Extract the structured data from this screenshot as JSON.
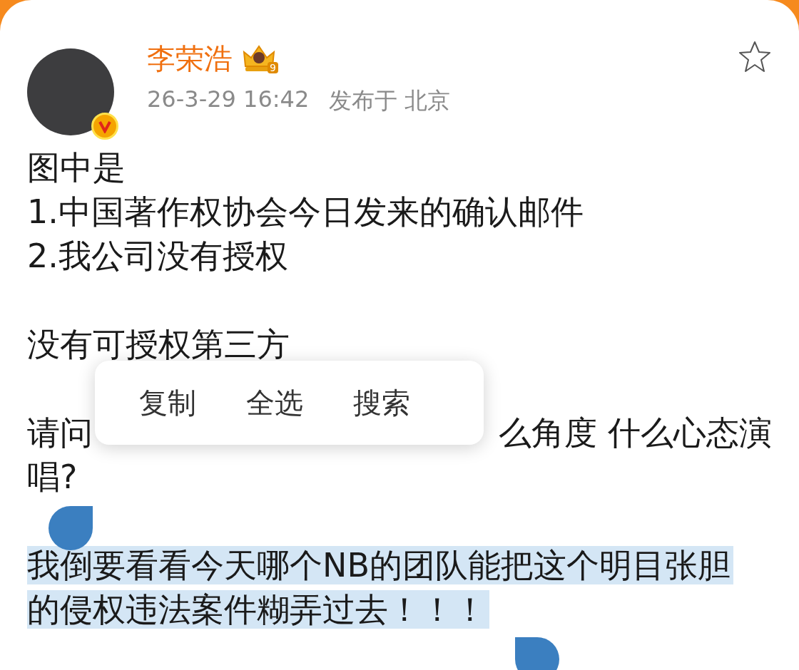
{
  "author": {
    "name": "李荣浩",
    "badge": "9",
    "verified": true
  },
  "post": {
    "time": "26-3-29 16:42",
    "location": "发布于 北京",
    "favorited": false
  },
  "paragraphs": [
    {
      "kind": "text",
      "text": "图中是\n1.中国著作权协会今日发来的确认邮件\n2.我公司没有授权",
      "selected": false
    },
    {
      "kind": "text",
      "text": "没有可授权第三方",
      "selected": false
    },
    {
      "kind": "covered",
      "fragments": [
        "请问",
        "么角度 什么心态演"
      ],
      "text": "唱?",
      "selected": false
    },
    {
      "kind": "text",
      "text": "我倒要看看今天哪个NB的团队能把这个明目张胆的侵权违法案件糊弄过去！！！",
      "selected": true
    }
  ],
  "context_menu": [
    "复制",
    "全选",
    "搜索"
  ]
}
